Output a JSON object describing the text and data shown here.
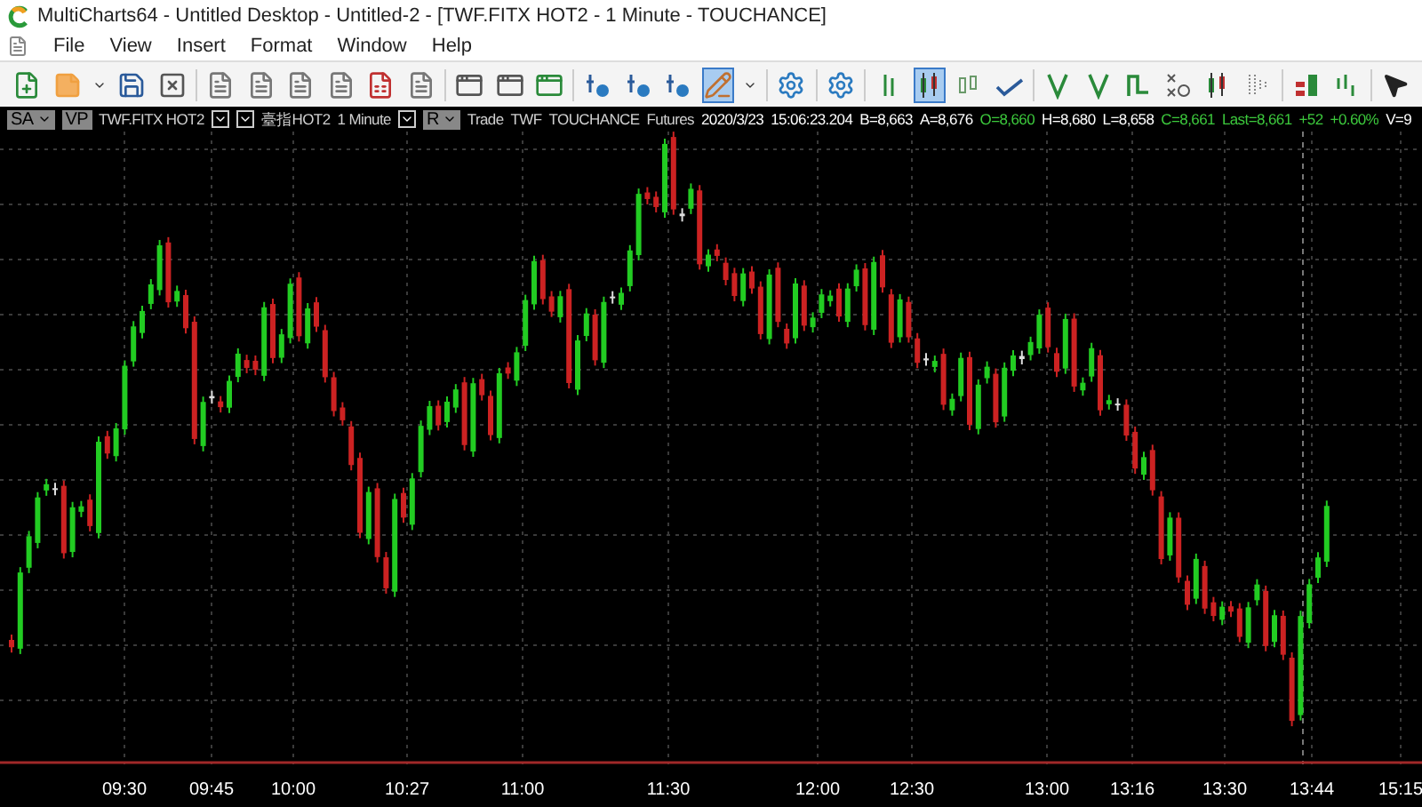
{
  "window": {
    "title": "MultiCharts64 - Untitled Desktop - Untitled-2 - [TWF.FITX HOT2 - 1 Minute - TOUCHANCE]"
  },
  "menu": [
    "File",
    "View",
    "Insert",
    "Format",
    "Window",
    "Help"
  ],
  "toolbar": [
    {
      "kind": "new-window",
      "selected": false
    },
    {
      "kind": "note",
      "selected": false
    },
    {
      "kind": "caret",
      "selected": false
    },
    {
      "kind": "save",
      "selected": false
    },
    {
      "kind": "close-window",
      "selected": false
    },
    {
      "kind": "sep"
    },
    {
      "kind": "doc",
      "selected": false
    },
    {
      "kind": "doc",
      "selected": false
    },
    {
      "kind": "doc",
      "selected": false
    },
    {
      "kind": "doc",
      "selected": false
    },
    {
      "kind": "doc-list",
      "selected": false
    },
    {
      "kind": "doc",
      "selected": false
    },
    {
      "kind": "sep"
    },
    {
      "kind": "window",
      "selected": false
    },
    {
      "kind": "window",
      "selected": false
    },
    {
      "kind": "window-add",
      "selected": false
    },
    {
      "kind": "sep"
    },
    {
      "kind": "add-study",
      "selected": false
    },
    {
      "kind": "add-study",
      "selected": false
    },
    {
      "kind": "add-study",
      "selected": false
    },
    {
      "kind": "draw",
      "selected": true
    },
    {
      "kind": "caret",
      "selected": false
    },
    {
      "kind": "sep"
    },
    {
      "kind": "settings",
      "selected": false
    },
    {
      "kind": "sep"
    },
    {
      "kind": "settings",
      "selected": false
    },
    {
      "kind": "sep"
    },
    {
      "kind": "bars",
      "selected": false
    },
    {
      "kind": "candles",
      "selected": true
    },
    {
      "kind": "hollow",
      "selected": false
    },
    {
      "kind": "line",
      "selected": false
    },
    {
      "kind": "sep"
    },
    {
      "kind": "v",
      "selected": false
    },
    {
      "kind": "v",
      "selected": false
    },
    {
      "kind": "step",
      "selected": false
    },
    {
      "kind": "xo",
      "selected": false
    },
    {
      "kind": "candles",
      "selected": false
    },
    {
      "kind": "dots",
      "selected": false
    },
    {
      "kind": "sep"
    },
    {
      "kind": "blocks",
      "selected": false
    },
    {
      "kind": "ticks",
      "selected": false
    },
    {
      "kind": "sep"
    },
    {
      "kind": "pointer",
      "selected": false
    }
  ],
  "chart_header": [
    {
      "kind": "dropdown",
      "text": "SA"
    },
    {
      "kind": "box",
      "text": "VP"
    },
    {
      "kind": "text",
      "text": "TWF.FITX HOT2",
      "color": "#d0d0d0"
    },
    {
      "kind": "caret"
    },
    {
      "kind": "caret-bar"
    },
    {
      "kind": "text",
      "text": "臺指HOT2",
      "color": "#d0d0d0"
    },
    {
      "kind": "text",
      "text": "1 Minute",
      "color": "#d0d0d0"
    },
    {
      "kind": "caret"
    },
    {
      "kind": "dropdown",
      "text": "R"
    },
    {
      "kind": "text",
      "text": "Trade",
      "color": "#d0d0d0"
    },
    {
      "kind": "text",
      "text": "TWF",
      "color": "#d0d0d0"
    },
    {
      "kind": "text",
      "text": "TOUCHANCE",
      "color": "#d0d0d0"
    },
    {
      "kind": "text",
      "text": "Futures",
      "color": "#d0d0d0"
    },
    {
      "kind": "text",
      "text": "2020/3/23",
      "color": "#ffffff"
    },
    {
      "kind": "text",
      "text": "15:06:23.204",
      "color": "#ffffff"
    },
    {
      "kind": "text",
      "text": "B=8,663",
      "color": "#ffffff"
    },
    {
      "kind": "text",
      "text": "A=8,676",
      "color": "#ffffff"
    },
    {
      "kind": "text",
      "text": "O=8,660",
      "color": "#3cc83c"
    },
    {
      "kind": "text",
      "text": "H=8,680",
      "color": "#ffffff"
    },
    {
      "kind": "text",
      "text": "L=8,658",
      "color": "#ffffff"
    },
    {
      "kind": "text",
      "text": "C=8,661",
      "color": "#3cc83c"
    },
    {
      "kind": "text",
      "text": "Last=8,661",
      "color": "#3cc83c"
    },
    {
      "kind": "text",
      "text": "+52",
      "color": "#3cc83c"
    },
    {
      "kind": "text",
      "text": "+0.60%",
      "color": "#3cc83c"
    },
    {
      "kind": "text",
      "text": "V=9",
      "color": "#ffffff"
    }
  ],
  "time_axis": [
    "09:30",
    "09:45",
    "10:00",
    "10:27",
    "11:00",
    "11:30",
    "12:00",
    "12:30",
    "13:00",
    "13:16",
    "13:30",
    "13:44",
    "15:15"
  ]
}
